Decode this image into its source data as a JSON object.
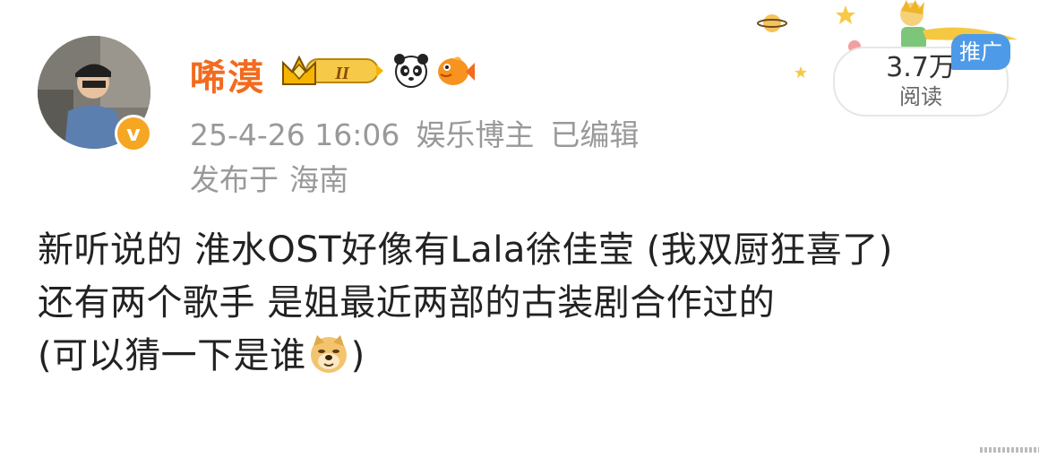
{
  "post": {
    "author": {
      "name": "唏漠",
      "avatar_icon": "user-avatar-photo",
      "verified_icon": "v-verified-icon",
      "verified_mark": "v",
      "badges": [
        "crown-level-badge",
        "panda-badge",
        "goldfish-badge"
      ],
      "level_mark": "II"
    },
    "meta": {
      "date": "25-4-26 16:06",
      "category": "娱乐博主",
      "edited": "已编辑",
      "location_prefix": "发布于",
      "location": "海南"
    },
    "stats": {
      "views_count": "3.7万",
      "views_label": "阅读",
      "promo_tag": "推广"
    },
    "content": {
      "line1": "新听说的 淮水OST好像有Lala徐佳莹 (我双厨狂喜了)",
      "line2": "还有两个歌手 是姐最近两部的古装剧合作过的",
      "line3_before": "(可以猜一下是谁",
      "line3_emoji": "doge-emoji",
      "line3_after": ")"
    },
    "colors": {
      "username": "#f26b1f",
      "meta_text": "#999999",
      "body_text": "#222222",
      "promo_tag": "#4d9ae8",
      "verified": "#f5a623"
    }
  }
}
